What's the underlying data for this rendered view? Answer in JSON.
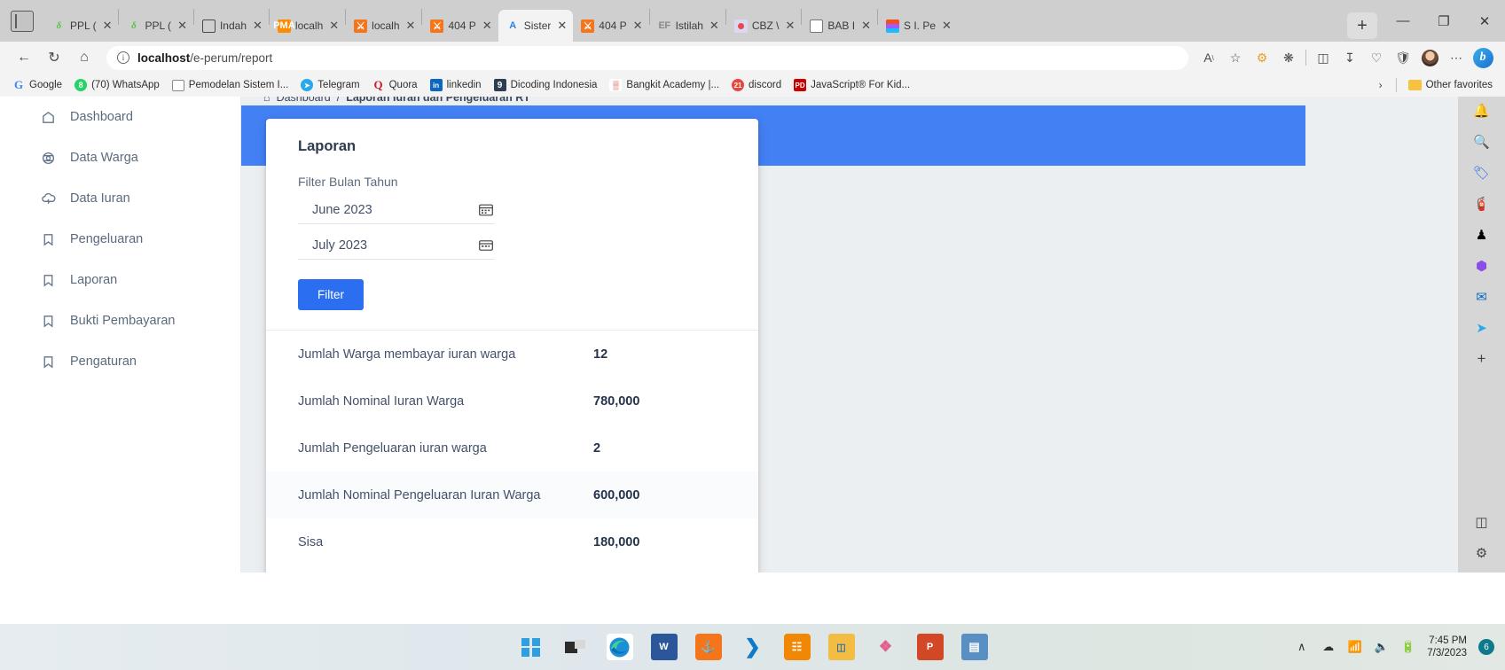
{
  "browser": {
    "tabs": [
      {
        "label": "PPL (",
        "favicon": "ppl-icon",
        "active": false
      },
      {
        "label": "PPL (",
        "favicon": "ppl-icon",
        "active": false
      },
      {
        "label": "Indah",
        "favicon": "github-icon",
        "active": false
      },
      {
        "label": "localh",
        "favicon": "phpmyadmin-icon",
        "active": false
      },
      {
        "label": "localh",
        "favicon": "xampp-icon",
        "active": false
      },
      {
        "label": "404 P",
        "favicon": "xampp-icon",
        "active": false
      },
      {
        "label": "Sister",
        "favicon": "apache-icon",
        "active": true
      },
      {
        "label": "404 P",
        "favicon": "xampp-icon",
        "active": false
      },
      {
        "label": "Istilah",
        "favicon": "ef-icon",
        "active": false
      },
      {
        "label": "CBZ \\",
        "favicon": "cbz-icon",
        "active": false
      },
      {
        "label": "BAB I",
        "favicon": "document-icon",
        "active": false
      },
      {
        "label": "S I. Pe",
        "favicon": "figma-icon",
        "active": false
      }
    ],
    "new_tab_label": "+",
    "window_controls": {
      "minimize": "—",
      "maximize": "❐",
      "close": "✕"
    },
    "nav": {
      "back": "←",
      "refresh": "↻",
      "home": "⌂"
    },
    "address": {
      "prefix": "localhost",
      "suffix": "/e-perum/report"
    },
    "toolbar_icons": [
      "read-aloud-icon",
      "favorite-star-icon",
      "extension-puzzle-icon",
      "collections-icon",
      "split-screen-icon",
      "downloads-icon",
      "performance-icon",
      "browser-essentials-icon",
      "profile-avatar",
      "settings-more-icon",
      "bing-copilot-icon"
    ],
    "bookmarks": [
      {
        "label": "Google",
        "icon": "google-icon"
      },
      {
        "label": "(70) WhatsApp",
        "icon": "whatsapp-icon"
      },
      {
        "label": "Pemodelan Sistem I...",
        "icon": "document-icon"
      },
      {
        "label": "Telegram",
        "icon": "telegram-icon"
      },
      {
        "label": "Quora",
        "icon": "quora-icon"
      },
      {
        "label": "linkedin",
        "icon": "linkedin-icon"
      },
      {
        "label": "Dicoding Indonesia",
        "icon": "dicoding-icon"
      },
      {
        "label": "Bangkit Academy |...",
        "icon": "bangkit-icon"
      },
      {
        "label": "discord",
        "icon": "discord-icon"
      },
      {
        "label": "JavaScript® For Kid...",
        "icon": "pdf-icon"
      }
    ],
    "bookmarks_overflow": "›",
    "other_favorites": "Other favorites"
  },
  "edge_sidebar": {
    "icons": [
      "notifications-bell-icon",
      "search-icon",
      "shopping-tag-icon",
      "tools-icon",
      "games-icon",
      "copilot-icon",
      "outlook-icon",
      "telegram-icon"
    ],
    "add_label": "+",
    "bottom_icons": [
      "split-screen-icon",
      "sidebar-settings-icon"
    ]
  },
  "sidebar": {
    "items": [
      {
        "label": "Dashboard",
        "icon": "home-icon"
      },
      {
        "label": "Data Warga",
        "icon": "users-icon"
      },
      {
        "label": "Data Iuran",
        "icon": "cloud-icon"
      },
      {
        "label": "Pengeluaran",
        "icon": "bookmark-icon"
      },
      {
        "label": "Laporan",
        "icon": "bookmark-icon"
      },
      {
        "label": "Bukti Pembayaran",
        "icon": "bookmark-icon"
      },
      {
        "label": "Pengaturan",
        "icon": "bookmark-icon"
      }
    ]
  },
  "breadcrumb": {
    "home_icon": "home-icon",
    "root": "Dashboard",
    "separator": "/",
    "current": "Laporan Iuran dan Pengeluaran RT"
  },
  "report_card": {
    "title": "Laporan",
    "filter_label": "Filter Bulan Tahun",
    "date_from": "June 2023",
    "date_to": "July 2023",
    "calendar_icon": "calendar-icon",
    "filter_button": "Filter",
    "stats": [
      {
        "label": "Jumlah Warga membayar iuran warga",
        "value": "12",
        "highlight": false
      },
      {
        "label": "Jumlah Nominal Iuran Warga",
        "value": "780,000",
        "highlight": false
      },
      {
        "label": "Jumlah Pengeluaran iuran warga",
        "value": "2",
        "highlight": false
      },
      {
        "label": "Jumlah Nominal Pengeluaran Iuran Warga",
        "value": "600,000",
        "highlight": true
      },
      {
        "label": "Sisa",
        "value": "180,000",
        "highlight": false
      }
    ]
  },
  "taskbar": {
    "icons": [
      "windows-start-icon",
      "task-view-icon",
      "microsoft-edge-icon",
      "microsoft-word-icon",
      "xampp-icon",
      "vscode-icon",
      "drawio-icon",
      "file-explorer-icon",
      "dia-diagram-icon",
      "powerpoint-icon",
      "calculator-icon"
    ],
    "tray": {
      "show_hidden": "∧",
      "onedrive_icon": "cloud-icon",
      "wifi_icon": "wifi-icon",
      "volume_icon": "volume-icon",
      "battery_icon": "battery-icon",
      "time": "7:45 PM",
      "date": "7/3/2023",
      "notification_count": "6"
    }
  },
  "colors": {
    "accent_blue": "#4280f4",
    "button_blue": "#2b6ff0",
    "page_bg": "#eceff2",
    "text_dark": "#24324a",
    "text_muted": "#5b6b7d"
  }
}
